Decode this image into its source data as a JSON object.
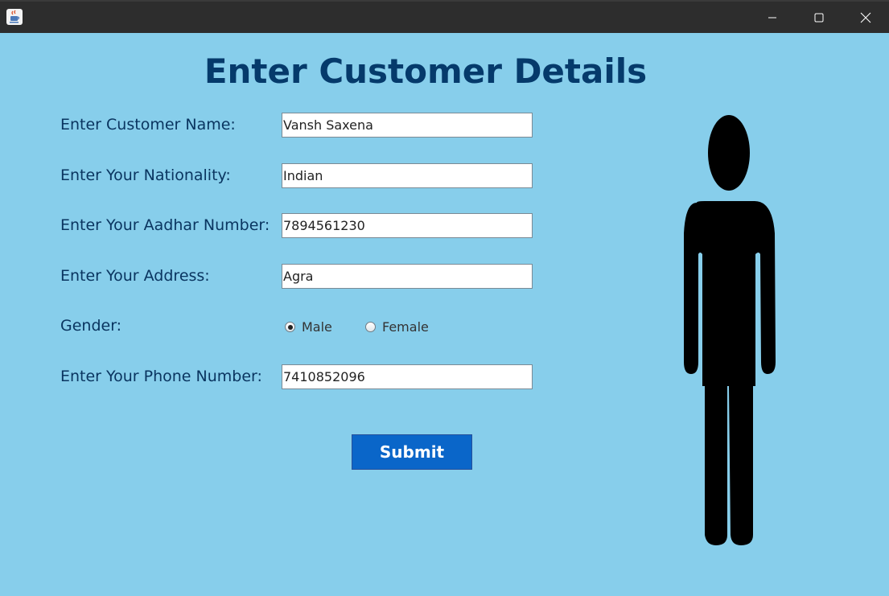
{
  "window": {
    "icon": "java-cup-icon",
    "controls": [
      "minimize-icon",
      "maximize-icon",
      "close-icon"
    ]
  },
  "form": {
    "title": "Enter Customer Details",
    "fields": [
      {
        "label": "Enter Customer Name:",
        "value": "Vansh Saxena"
      },
      {
        "label": "Enter Your Nationality:",
        "value": "Indian"
      },
      {
        "label": "Enter Your Aadhar Number:",
        "value": "7894561230"
      },
      {
        "label": "Enter Your Address:",
        "value": "Agra"
      }
    ],
    "gender": {
      "label": "Gender:",
      "options": [
        "Male",
        "Female"
      ],
      "selected": "Male"
    },
    "phone": {
      "label": "Enter Your Phone Number:",
      "value": "7410852096"
    },
    "submit_label": "Submit"
  },
  "colors": {
    "background": "#87ceeb",
    "title": "#053a6b",
    "labels": "#0a3560",
    "button": "#0a66c9"
  },
  "illustration": "person-silhouette-icon"
}
